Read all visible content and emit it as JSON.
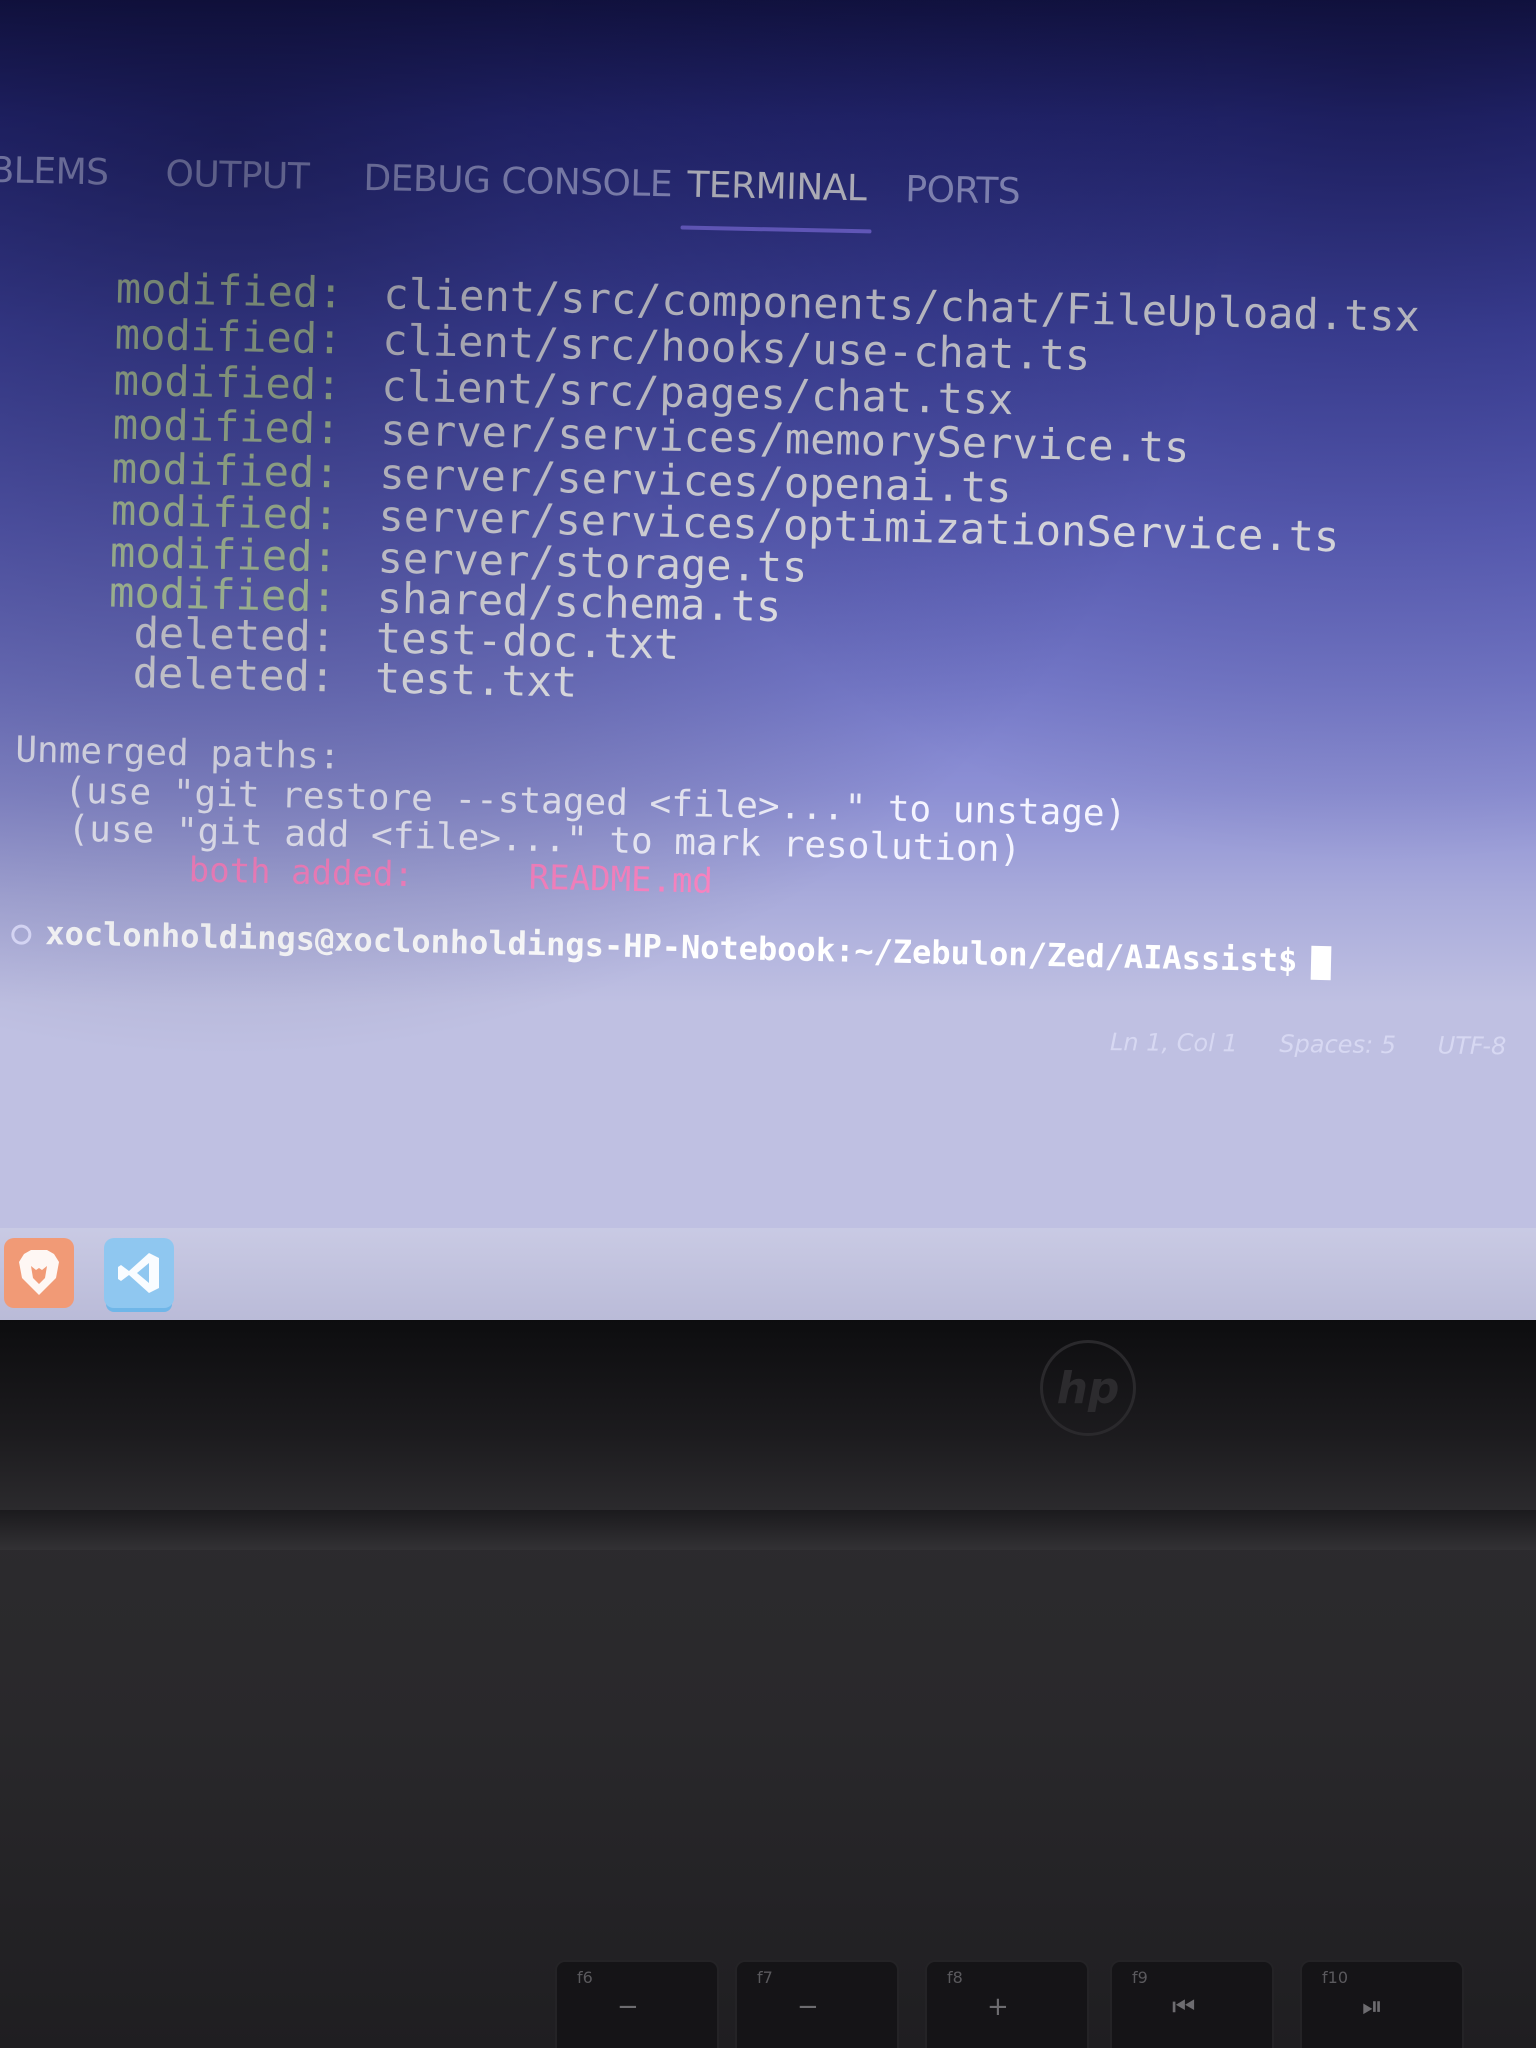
{
  "panel": {
    "tabs": [
      {
        "label": "BLEMS",
        "active": false
      },
      {
        "label": "OUTPUT",
        "active": false
      },
      {
        "label": "DEBUG CONSOLE",
        "active": false
      },
      {
        "label": "TERMINAL",
        "active": true
      },
      {
        "label": "PORTS",
        "active": false
      }
    ]
  },
  "terminal": {
    "changes": [
      {
        "status": "modified:",
        "path": "client/src/components/chat/FileUpload.tsx"
      },
      {
        "status": "modified:",
        "path": "client/src/hooks/use-chat.ts"
      },
      {
        "status": "modified:",
        "path": "client/src/pages/chat.tsx"
      },
      {
        "status": "modified:",
        "path": "server/services/memoryService.ts"
      },
      {
        "status": "modified:",
        "path": "server/services/openai.ts"
      },
      {
        "status": "modified:",
        "path": "server/services/optimizationService.ts"
      },
      {
        "status": "modified:",
        "path": "server/storage.ts"
      },
      {
        "status": "modified:",
        "path": "shared/schema.ts"
      },
      {
        "status": "deleted:",
        "path": "test-doc.txt"
      },
      {
        "status": "deleted:",
        "path": "test.txt"
      }
    ],
    "unmerged": {
      "heading": "Unmerged paths:",
      "hints": [
        "(use \"git restore --staged <file>...\" to unstage)",
        "(use \"git add <file>...\" to mark resolution)"
      ],
      "conflicts": [
        {
          "status": "both added:",
          "path": "README.md"
        }
      ]
    },
    "prompt": "xoclonholdings@xoclonholdings-HP-Notebook:~/Zebulon/Zed/AIAssist$"
  },
  "status_bar": {
    "position": "Ln 1, Col 1",
    "spaces": "Spaces: 5",
    "encoding": "UTF-8"
  },
  "taskbar": {
    "apps": [
      {
        "name": "brave-icon"
      },
      {
        "name": "vscode-icon"
      }
    ]
  },
  "keyboard": {
    "keys": [
      {
        "label": "f6",
        "glyph": "−"
      },
      {
        "label": "f7",
        "glyph": "−"
      },
      {
        "label": "f8",
        "glyph": "+"
      },
      {
        "label": "f9",
        "glyph": "⏮"
      },
      {
        "label": "f10",
        "glyph": "⏯"
      }
    ]
  },
  "colors": {
    "tab_active_underline": "#8b7cff",
    "modified_status": "#cde9b0",
    "conflict": "#ff86c4"
  }
}
